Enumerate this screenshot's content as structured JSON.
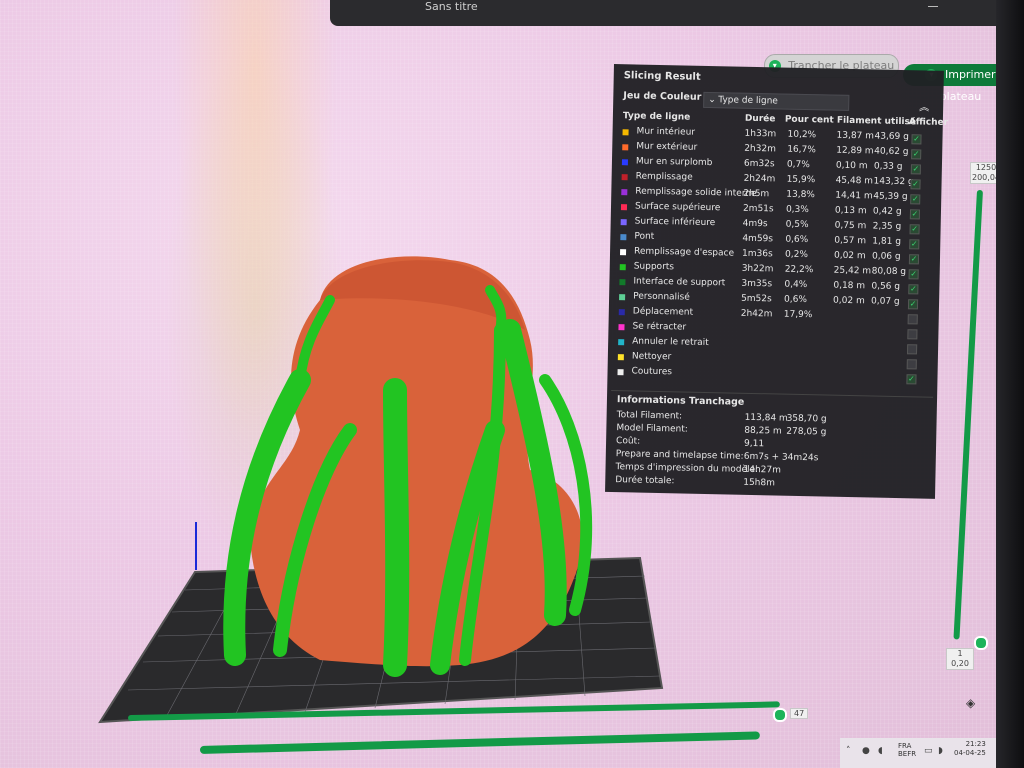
{
  "window": {
    "title": "Sans titre"
  },
  "toolbar": {
    "slice_label": "Trancher le plateau",
    "print_label": "Imprimer plateau"
  },
  "panel": {
    "title": "Slicing Result",
    "color_scheme_label": "Jeu de Couleur",
    "color_scheme_value": "Type de ligne",
    "headers": {
      "type": "Type de ligne",
      "duration": "Durée",
      "percent": "Pour cent",
      "filament": "Filament utilisé",
      "show": "Afficher"
    },
    "rows": [
      {
        "name": "Mur intérieur",
        "color": "#f5b800",
        "duration": "1h33m",
        "percent": "10,2%",
        "len": "13,87 m",
        "weight": "43,69 g",
        "show": true
      },
      {
        "name": "Mur extérieur",
        "color": "#ff6a2a",
        "duration": "2h32m",
        "percent": "16,7%",
        "len": "12,89 m",
        "weight": "40,62 g",
        "show": true
      },
      {
        "name": "Mur en surplomb",
        "color": "#2a3bff",
        "duration": "6m32s",
        "percent": "0,7%",
        "len": "0,10 m",
        "weight": "0,33 g",
        "show": true
      },
      {
        "name": "Remplissage",
        "color": "#c0202a",
        "duration": "2h24m",
        "percent": "15,9%",
        "len": "45,48 m",
        "weight": "143,32 g",
        "show": true
      },
      {
        "name": "Remplissage solide interne",
        "color": "#9b30d9",
        "duration": "2h5m",
        "percent": "13,8%",
        "len": "14,41 m",
        "weight": "45,39 g",
        "show": true
      },
      {
        "name": "Surface supérieure",
        "color": "#ff2a55",
        "duration": "2m51s",
        "percent": "0,3%",
        "len": "0,13 m",
        "weight": "0,42 g",
        "show": true
      },
      {
        "name": "Surface inférieure",
        "color": "#7a66ff",
        "duration": "4m9s",
        "percent": "0,5%",
        "len": "0,75 m",
        "weight": "2,35 g",
        "show": true
      },
      {
        "name": "Pont",
        "color": "#4a8acc",
        "duration": "4m59s",
        "percent": "0,6%",
        "len": "0,57 m",
        "weight": "1,81 g",
        "show": true
      },
      {
        "name": "Remplissage d'espace",
        "color": "#ffffff",
        "duration": "1m36s",
        "percent": "0,2%",
        "len": "0,02 m",
        "weight": "0,06 g",
        "show": true
      },
      {
        "name": "Supports",
        "color": "#22c422",
        "duration": "3h22m",
        "percent": "22,2%",
        "len": "25,42 m",
        "weight": "80,08 g",
        "show": true
      },
      {
        "name": "Interface de support",
        "color": "#127a2a",
        "duration": "3m35s",
        "percent": "0,4%",
        "len": "0,18 m",
        "weight": "0,56 g",
        "show": true
      },
      {
        "name": "Personnalisé",
        "color": "#5ecf95",
        "duration": "5m52s",
        "percent": "0,6%",
        "len": "0,02 m",
        "weight": "0,07 g",
        "show": true
      },
      {
        "name": "Déplacement",
        "color": "#2a2aa8",
        "duration": "2h42m",
        "percent": "17,9%",
        "len": "",
        "weight": "",
        "show": false
      },
      {
        "name": "Se rétracter",
        "color": "#ff33cc",
        "duration": "",
        "percent": "",
        "len": "",
        "weight": "",
        "show": false
      },
      {
        "name": "Annuler le retrait",
        "color": "#22b5c9",
        "duration": "",
        "percent": "",
        "len": "",
        "weight": "",
        "show": false
      },
      {
        "name": "Nettoyer",
        "color": "#ffe22a",
        "duration": "",
        "percent": "",
        "len": "",
        "weight": "",
        "show": false
      },
      {
        "name": "Coutures",
        "color": "#eeeeee",
        "duration": "",
        "percent": "",
        "len": "",
        "weight": "",
        "show": true
      }
    ],
    "info_title": "Informations Tranchage",
    "info": [
      {
        "label": "Total Filament:",
        "v1": "113,84 m",
        "v2": "358,70 g"
      },
      {
        "label": "Model Filament:",
        "v1": "88,25 m",
        "v2": "278,05 g"
      },
      {
        "label": "Coût:",
        "v1": "9,11",
        "v2": ""
      },
      {
        "label": "Prepare and timelapse time:",
        "v1": "6m7s + 34m24s",
        "v2": ""
      },
      {
        "label": "Temps d'impression du modèle:",
        "v1": "14h27m",
        "v2": ""
      },
      {
        "label": "Durée totale:",
        "v1": "15h8m",
        "v2": ""
      }
    ]
  },
  "layer_slider": {
    "top_layer": "1250",
    "top_height": "200,04",
    "bottom_layer": "1",
    "bottom_height": "0,20"
  },
  "move_slider": {
    "value": "47"
  },
  "taskbar": {
    "lang_top": "FRA",
    "lang_bottom": "BEFR",
    "time": "21:23",
    "date": "04-04-25"
  },
  "colors": {
    "support_green": "#22c422",
    "model_orange": "#d9623a",
    "accent": "#139a47"
  }
}
